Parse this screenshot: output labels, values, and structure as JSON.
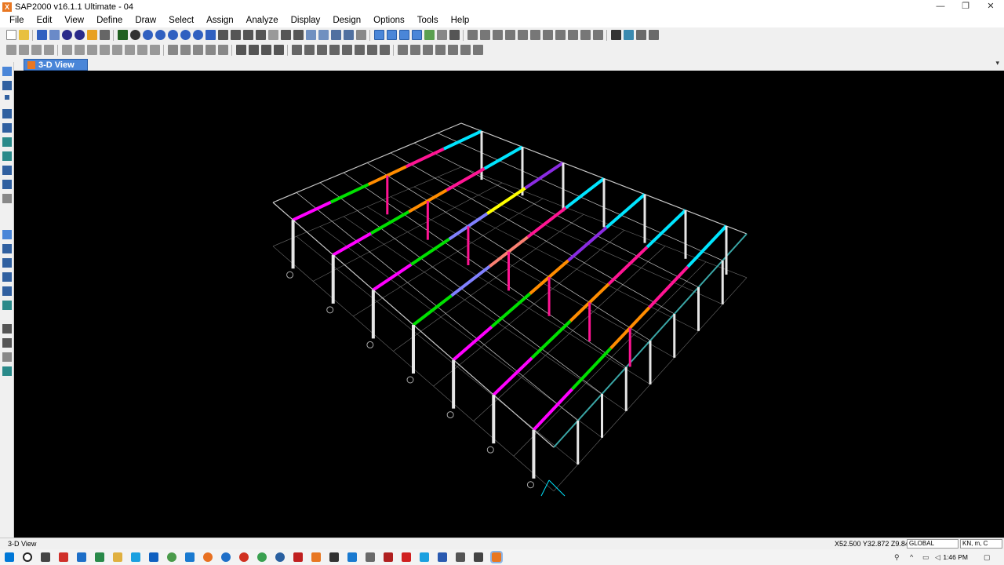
{
  "window": {
    "title": "SAP2000 v16.1.1 Ultimate  - 04",
    "minimize": "—",
    "maximize": "❐",
    "close": "✕"
  },
  "menu": [
    "File",
    "Edit",
    "View",
    "Define",
    "Draw",
    "Select",
    "Assign",
    "Analyze",
    "Display",
    "Design",
    "Options",
    "Tools",
    "Help"
  ],
  "tab": {
    "label": "3-D View",
    "dropdown": "▾"
  },
  "status": {
    "view": "3-D View",
    "coords": "X52.500  Y32.872  Z9.847",
    "coord_system": "GLOBAL",
    "units": "KN, m, C"
  },
  "taskbar": {
    "time": "1:46 PM"
  },
  "colors": {
    "canvas_bg": "#000000",
    "grid": "#c8c8c8",
    "column": "#e6e6e6",
    "cyan": "#00e5ff",
    "magenta": "#ff00ff",
    "green": "#00e000",
    "orange": "#ff8c00",
    "pink": "#ff1493",
    "yellow": "#ffff00",
    "purple": "#8a2be2",
    "lavender": "#8080ff",
    "salmon": "#fa8072",
    "teal": "#3aa6a6"
  }
}
